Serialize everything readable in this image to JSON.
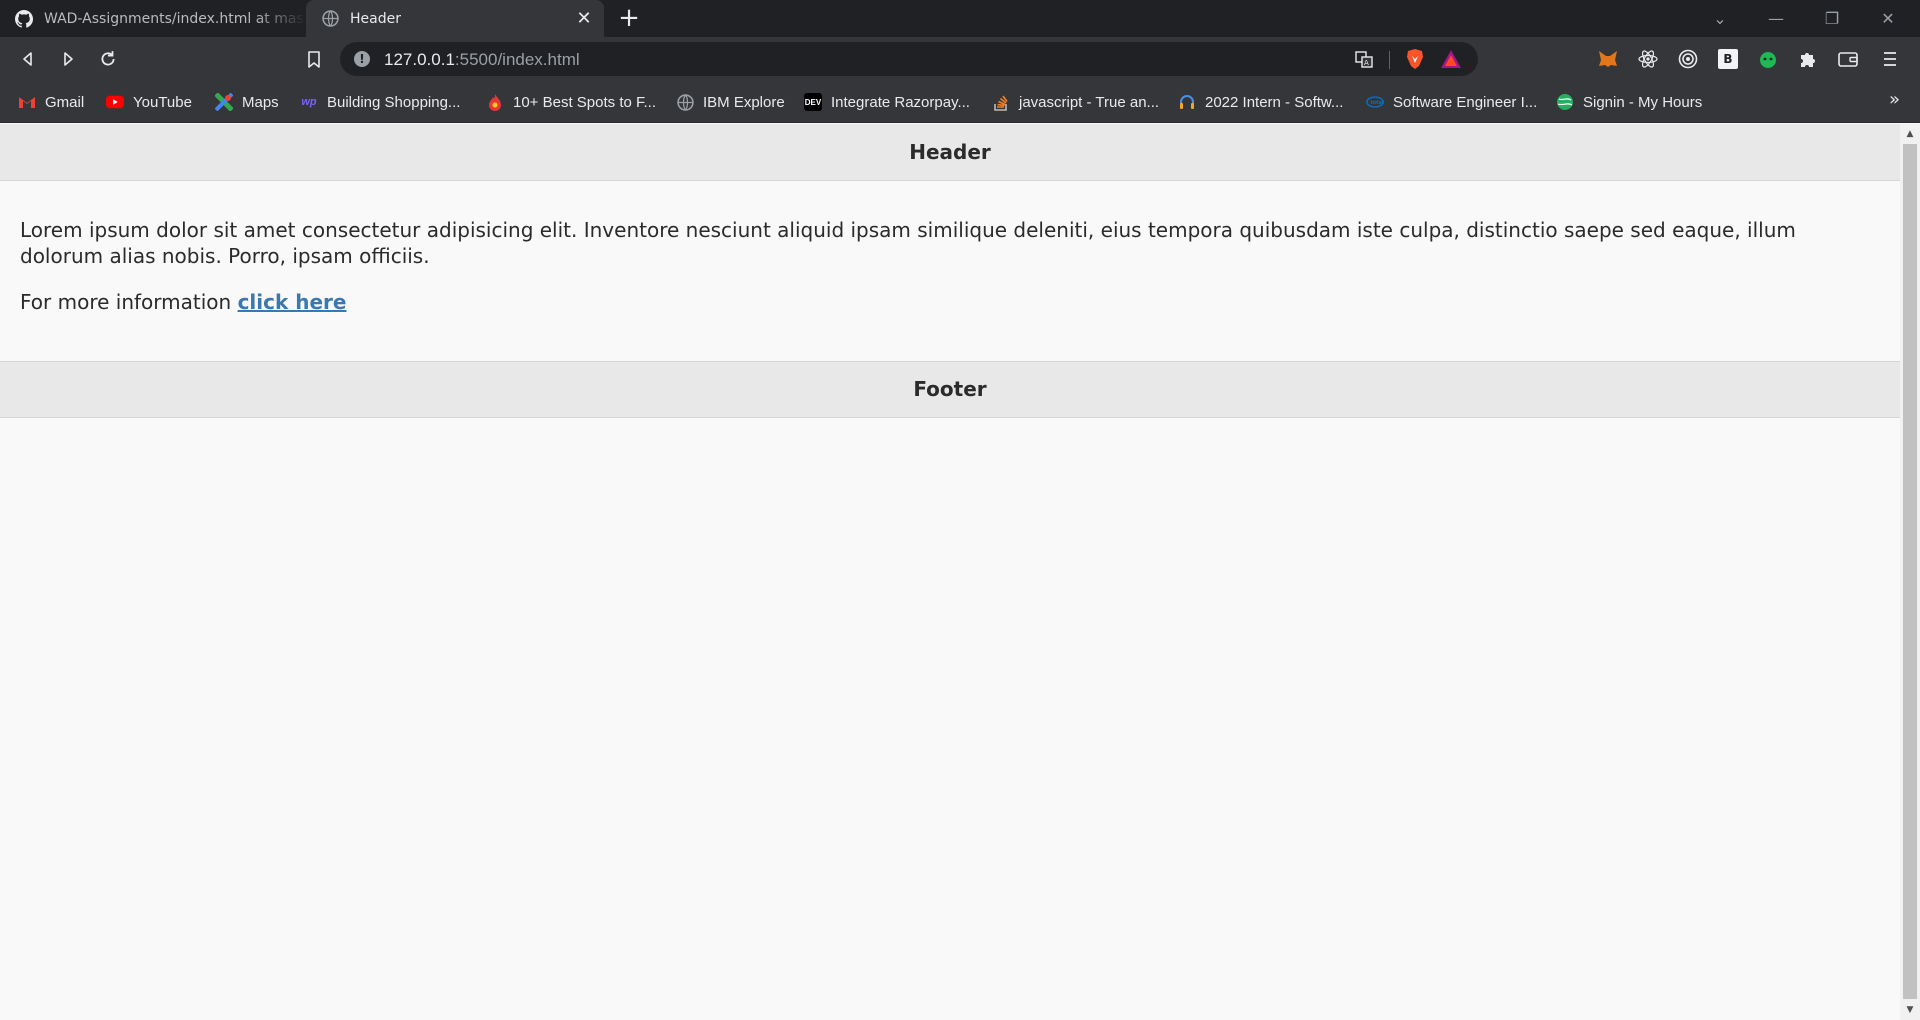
{
  "browser": {
    "tabs": [
      {
        "title": "WAD-Assignments/index.html at mast",
        "icon": "github-icon",
        "active": false
      },
      {
        "title": "Header",
        "icon": "globe-icon",
        "active": true
      }
    ],
    "url_host": "127.0.0.1",
    "url_rest": ":5500/index.html",
    "bookmarks": [
      {
        "label": "Gmail",
        "icon": "gmail-icon",
        "color": "#ea4335"
      },
      {
        "label": "YouTube",
        "icon": "youtube-icon",
        "color": "#ff0000"
      },
      {
        "label": "Maps",
        "icon": "maps-icon",
        "color": "#34a853"
      },
      {
        "label": "Building Shopping...",
        "icon": "wp-icon",
        "color": "#7b61ff"
      },
      {
        "label": "10+ Best Spots to F...",
        "icon": "flame-icon",
        "color": "#e53935"
      },
      {
        "label": "IBM Explore",
        "icon": "globe-icon",
        "color": "#9aa0a6"
      },
      {
        "label": "Integrate Razorpay...",
        "icon": "dev-icon",
        "color": "#000000"
      },
      {
        "label": "javascript - True an...",
        "icon": "stackoverflow-icon",
        "color": "#f48024"
      },
      {
        "label": "2022 Intern - Softw...",
        "icon": "headset-icon",
        "color": "#4a90e2"
      },
      {
        "label": "Software Engineer I...",
        "icon": "intel-icon",
        "color": "#0071c5"
      },
      {
        "label": "Signin - My Hours",
        "icon": "globe-green-icon",
        "color": "#27ae60"
      }
    ],
    "bookmarks_overflow": "»"
  },
  "page": {
    "header": "Header",
    "paragraph": "Lorem ipsum dolor sit amet consectetur adipisicing elit. Inventore nesciunt aliquid ipsam similique deleniti, eius tempora quibusdam iste culpa, distinctio saepe sed eaque, illum dolorum alias nobis. Porro, ipsam officiis.",
    "more_info_prefix": "For more information ",
    "more_info_link": "click here",
    "footer": "Footer"
  }
}
